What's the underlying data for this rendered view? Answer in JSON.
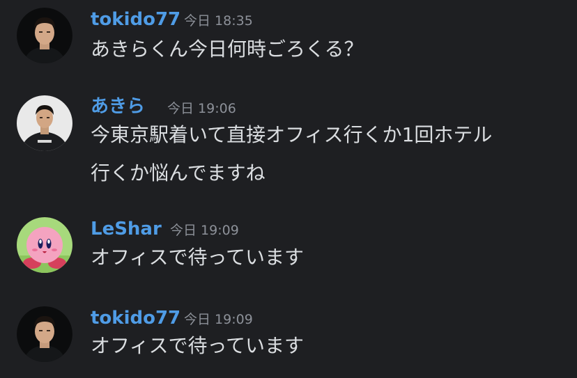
{
  "colors": {
    "background": "#1e1f22",
    "username": "#4f9ce6",
    "timestamp": "#8d9199",
    "message_text": "#dbdee1"
  },
  "messages": [
    {
      "username": "tokido77",
      "timestamp": "今日 18:35",
      "lines": [
        "あきらくん今日何時ごろくる？"
      ],
      "avatar_icon": "tokido-avatar-icon"
    },
    {
      "username": "あきら",
      "timestamp": "今日 19:06",
      "lines": [
        "今東京駅着いて直接オフィス行くか1回ホテル",
        "行くか悩んでますね"
      ],
      "avatar_icon": "akira-avatar-icon"
    },
    {
      "username": "LeShar",
      "timestamp": "今日 19:09",
      "lines": [
        "オフィスで待っています"
      ],
      "avatar_icon": "kirby-avatar-icon"
    },
    {
      "username": "tokido77",
      "timestamp": "今日 19:09",
      "lines": [
        "オフィスで待っています"
      ],
      "avatar_icon": "tokido-avatar-icon"
    }
  ]
}
